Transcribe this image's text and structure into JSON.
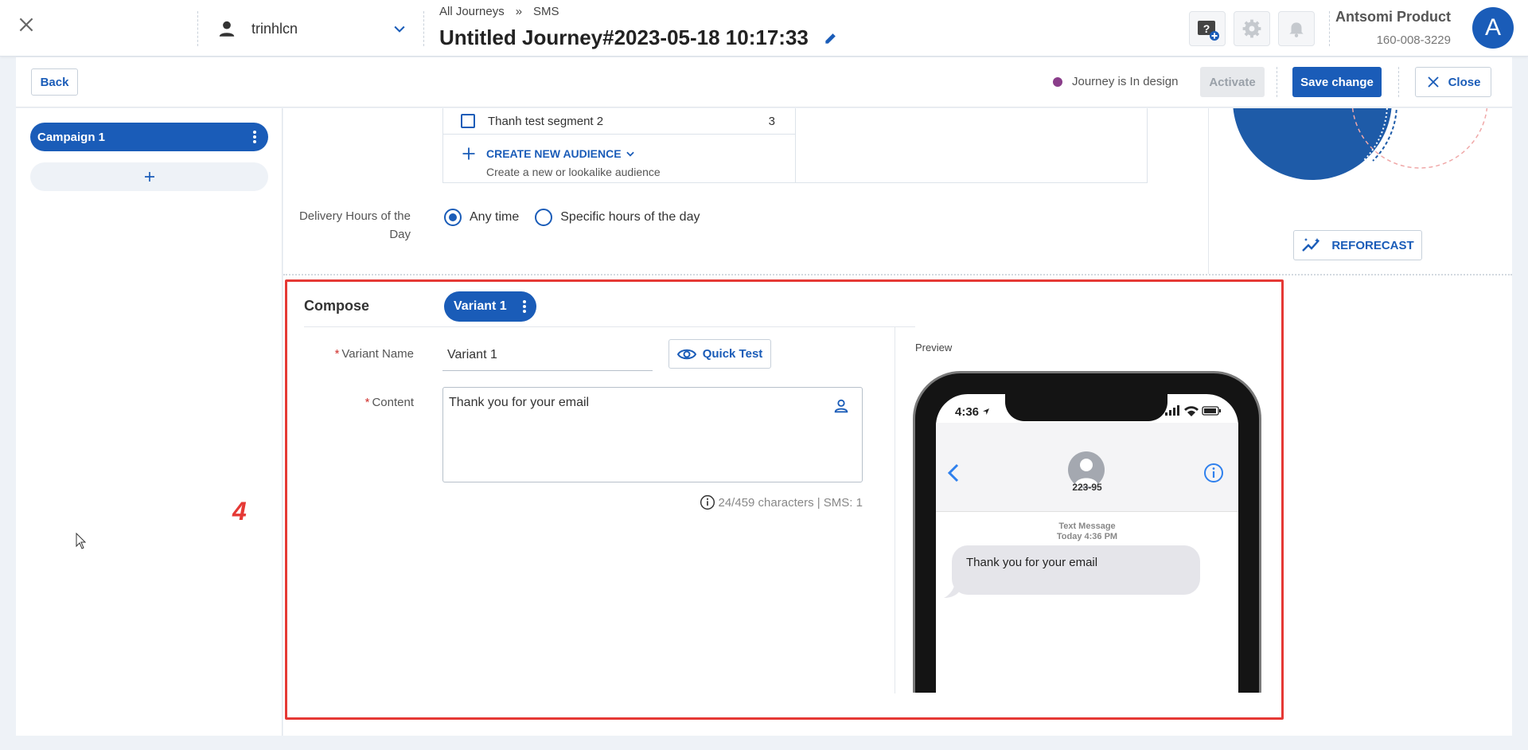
{
  "header": {
    "username": "trinhlcn",
    "breadcrumb_root": "All Journeys",
    "breadcrumb_sep": "»",
    "breadcrumb_current": "SMS",
    "journey_title": "Untitled Journey#2023-05-18 10:17:33",
    "org_name": "Antsomi Product",
    "org_id": "160-008-3229",
    "avatar_letter": "A"
  },
  "actionbar": {
    "back": "Back",
    "status_text": "Journey is In design",
    "status_color": "#8a3d8a",
    "activate": "Activate",
    "save": "Save change",
    "close": "Close"
  },
  "sidebar": {
    "campaign": "Campaign 1",
    "add_label": "+"
  },
  "segments": {
    "row_name": "Thanh test segment 2",
    "row_count": "3",
    "create_new": "CREATE NEW AUDIENCE",
    "create_sub": "Create a new or lookalike audience"
  },
  "delivery": {
    "label": "Delivery Hours of the Day",
    "option_any": "Any time",
    "option_specific": "Specific hours of the day",
    "selected": "Any time"
  },
  "forecast": {
    "reforecast": "REFORECAST"
  },
  "compose": {
    "title": "Compose",
    "variant_tab": "Variant 1",
    "variant_name_label": "Variant Name",
    "variant_name_value": "Variant 1",
    "quick_test": "Quick Test",
    "content_label": "Content",
    "content_value": "Thank you for your email",
    "char_count": "24/459 characters | SMS: 1",
    "required_mark": "*"
  },
  "preview": {
    "label": "Preview",
    "time": "4:36",
    "contact": "223-95",
    "meta_title": "Text Message",
    "meta_time": "Today 4:36 PM",
    "message": "Thank you for your email"
  },
  "annotation": {
    "number": "4",
    "color": "#e53935"
  },
  "theme": {
    "primary": "#1a5cb8"
  }
}
